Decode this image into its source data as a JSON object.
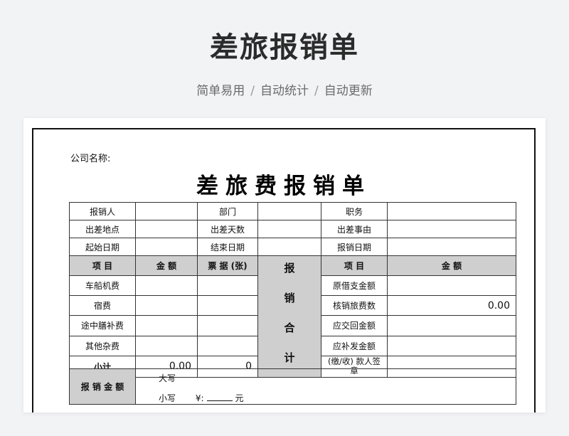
{
  "hero": {
    "title": "差旅报销单",
    "tags": [
      "简单易用",
      "自动统计",
      "自动更新"
    ],
    "separator": "/"
  },
  "form": {
    "company_label": "公司名称:",
    "title": "差旅费报销单",
    "info_rows": [
      [
        "报销人",
        "部门",
        "职务"
      ],
      [
        "出差地点",
        "出差天数",
        "出差事由"
      ],
      [
        "起始日期",
        "结束日期",
        "报销日期"
      ]
    ],
    "left_headers": [
      "项 目",
      "金 额",
      "票 据 (张)"
    ],
    "middle_vertical": [
      "报",
      "销",
      "合",
      "计"
    ],
    "right_headers": [
      "项 目",
      "金 额"
    ],
    "left_items": [
      "车船机费",
      "宿费",
      "途中膳补费",
      "其他杂费"
    ],
    "subtotal": {
      "label": "小计",
      "amount": "0.00",
      "receipts": "0"
    },
    "right_items": [
      "原借支金额",
      "核销旅费数",
      "应交回金额",
      "应补发金额",
      "(缴/收) 款人签章"
    ],
    "right_values": [
      "",
      "0.00",
      "",
      "",
      ""
    ],
    "total": {
      "label": "报 销 金 额",
      "daxie": "大写",
      "xiaoxie": "小写",
      "currency": "¥:",
      "unit": "元"
    }
  },
  "colors": {
    "header_gray": "#cfcfcf",
    "total_red": "#e60012",
    "background": "#f2f3f5"
  }
}
